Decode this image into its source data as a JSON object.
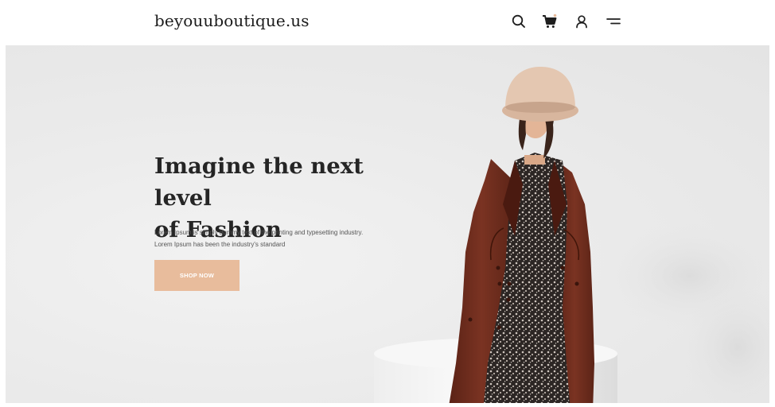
{
  "header": {
    "logo": "beyouuboutique.us",
    "icons": [
      "search-icon",
      "cart-icon",
      "user-icon",
      "menu-icon"
    ]
  },
  "hero": {
    "title_line1": "Imagine the next level",
    "title_line2": "of Fashion",
    "subtitle_line1": "Lorem Ipsum is simply dummy text of the printing and typesetting industry.",
    "subtitle_line2": "Lorem Ipsum has been the industry's standard",
    "cta_label": "SHOP NOW"
  },
  "colors": {
    "cta_background": "#e8bc9c",
    "coat": "#6e2c1c",
    "hat": "#e2c4ae",
    "backdrop": "#ebebeb"
  }
}
